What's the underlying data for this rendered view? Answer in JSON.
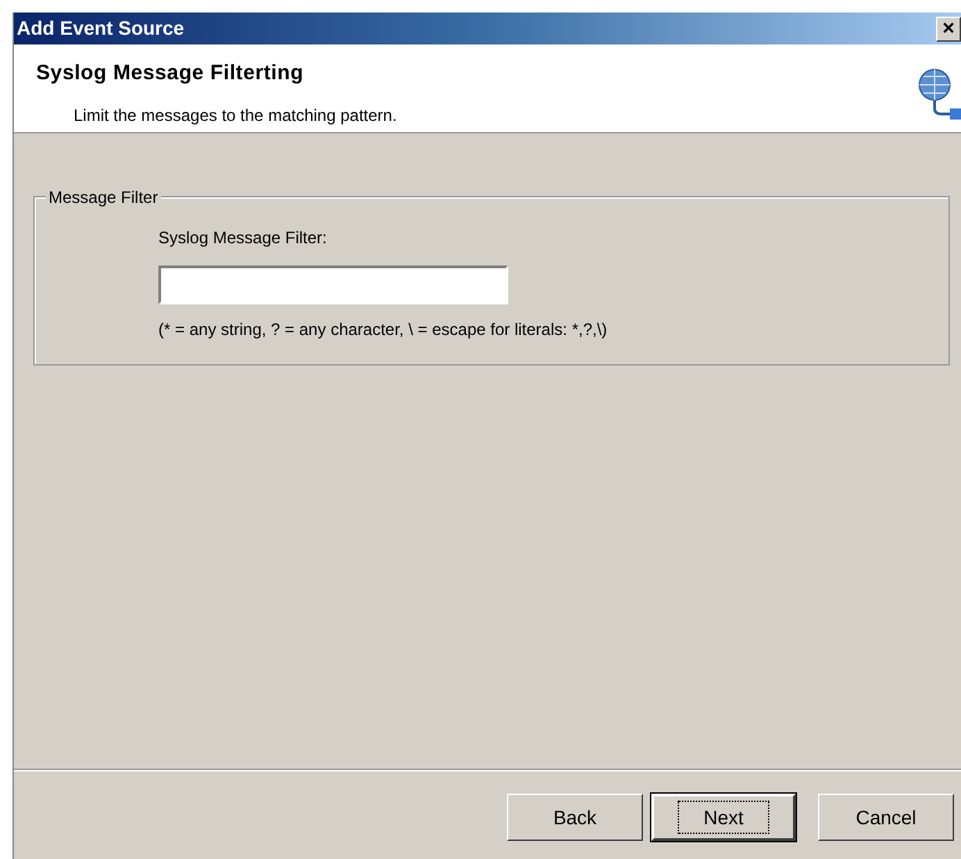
{
  "window": {
    "title": "Add Event Source",
    "close": "×"
  },
  "header": {
    "title": "Syslog Message Filterting",
    "subtitle": "Limit the messages to the matching pattern."
  },
  "group": {
    "legend": "Message Filter",
    "label": "Syslog Message Filter:",
    "hint": "(* = any string, ? = any character, \\ = escape for literals: *,?,\\)"
  },
  "buttons": [
    {
      "label": "Back",
      "default": false
    },
    {
      "label": "Next",
      "default": true
    },
    {
      "label": "Cancel",
      "default": false
    }
  ]
}
